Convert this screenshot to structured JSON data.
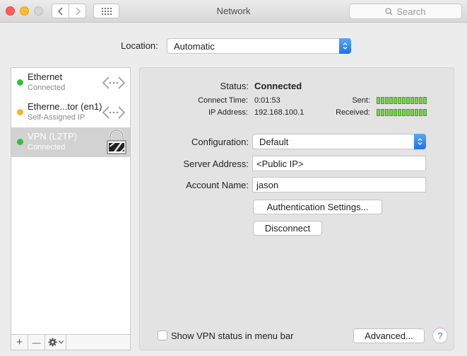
{
  "window": {
    "title": "Network"
  },
  "search": {
    "placeholder": "Search"
  },
  "location": {
    "label": "Location:",
    "value": "Automatic"
  },
  "services": [
    {
      "name": "Ethernet",
      "status": "Connected",
      "dot_color": "#2fc23a",
      "icon": "ethernet-arrows-icon"
    },
    {
      "name": "Etherne...tor (en1)",
      "status": "Self-Assigned IP",
      "dot_color": "#f5b62a",
      "icon": "ethernet-arrows-icon"
    },
    {
      "name": "VPN (L2TP)",
      "status": "Connected",
      "dot_color": "#2fc23a",
      "icon": "vpn-lock-icon",
      "selected": true
    }
  ],
  "sidebar_buttons": {
    "add": "+",
    "remove": "—"
  },
  "detail": {
    "status_label": "Status:",
    "status_value": "Connected",
    "connect_time_label": "Connect Time:",
    "connect_time_value": "0:01:53",
    "ip_label": "IP Address:",
    "ip_value": "192.168.100.1",
    "sent_label": "Sent:",
    "received_label": "Received:",
    "configuration_label": "Configuration:",
    "configuration_value": "Default",
    "server_label": "Server Address:",
    "server_value": "<Public IP>",
    "account_label": "Account Name:",
    "account_value": "jason",
    "auth_button": "Authentication Settings...",
    "disconnect_button": "Disconnect",
    "show_vpn_label": "Show VPN status in menu bar",
    "advanced_button": "Advanced...",
    "help": "?"
  },
  "colors": {
    "accent": "#2f7cf6",
    "connected": "#2fc23a",
    "self_assigned": "#f5b62a",
    "meter": "#7bd34c"
  }
}
